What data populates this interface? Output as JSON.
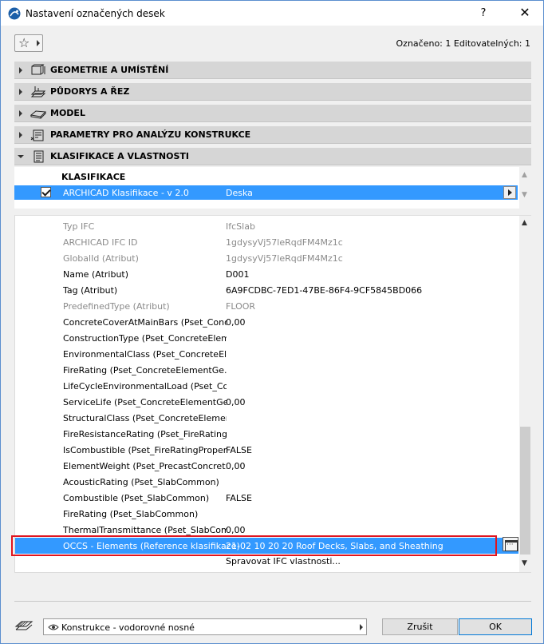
{
  "window": {
    "title": "Nastavení označených desek",
    "help_label": "?",
    "close_label": "✕"
  },
  "toolbar": {
    "favorites_icon": "star-icon",
    "selection_info": "Označeno: 1 Editovatelných: 1"
  },
  "sections": [
    {
      "label": "GEOMETRIE A UMÍSTĚNÍ",
      "icon": "geometry-icon",
      "expanded": false
    },
    {
      "label": "PŮDORYS A ŘEZ",
      "icon": "floorplan-icon",
      "expanded": false
    },
    {
      "label": "MODEL",
      "icon": "model-icon",
      "expanded": false
    },
    {
      "label": "PARAMETRY PRO ANALÝZU KONSTRUKCE",
      "icon": "structural-icon",
      "expanded": false
    },
    {
      "label": "KLASIFIKACE A VLASTNOSTI",
      "icon": "classification-icon",
      "expanded": true
    }
  ],
  "classification": {
    "header": "KLASIFIKACE",
    "row": {
      "checked": true,
      "system": "ARCHICAD Klasifikace - v 2.0",
      "value": "Deska"
    }
  },
  "properties": [
    {
      "name": "Typ IFC",
      "value": "IfcSlab",
      "gray": true
    },
    {
      "name": "ARCHICAD IFC ID",
      "value": "1gdysyVj57leRqdFM4Mz1c",
      "gray": true
    },
    {
      "name": "GlobalId (Atribut)",
      "value": "1gdysyVj57leRqdFM4Mz1c",
      "gray": true
    },
    {
      "name": "Name (Atribut)",
      "value": "D001",
      "gray": false
    },
    {
      "name": "Tag (Atribut)",
      "value": "6A9FCDBC-7ED1-47BE-86F4-9CF5845BD066",
      "gray": false
    },
    {
      "name": "PredefinedType (Atribut)",
      "value": "FLOOR",
      "gray": true
    },
    {
      "name": "ConcreteCoverAtMainBars (Pset_Conc...",
      "value": "0,00",
      "gray": false
    },
    {
      "name": "ConstructionType (Pset_ConcreteElem...",
      "value": "",
      "gray": false
    },
    {
      "name": "EnvironmentalClass (Pset_ConcreteEl...",
      "value": "",
      "gray": false
    },
    {
      "name": "FireRating (Pset_ConcreteElementGe...",
      "value": "",
      "gray": false
    },
    {
      "name": "LifeCycleEnvironmentalLoad (Pset_Co...",
      "value": "",
      "gray": false
    },
    {
      "name": "ServiceLife (Pset_ConcreteElementGe...",
      "value": "0,00",
      "gray": false
    },
    {
      "name": "StructuralClass (Pset_ConcreteElemen...",
      "value": "",
      "gray": false
    },
    {
      "name": "FireResistanceRating (Pset_FireRating...",
      "value": "",
      "gray": false
    },
    {
      "name": "IsCombustible (Pset_FireRatingProper...",
      "value": "FALSE",
      "gray": false
    },
    {
      "name": "ElementWeight (Pset_PrecastConcret...",
      "value": "0,00",
      "gray": false
    },
    {
      "name": "AcousticRating (Pset_SlabCommon)",
      "value": "",
      "gray": false
    },
    {
      "name": "Combustible (Pset_SlabCommon)",
      "value": "FALSE",
      "gray": false
    },
    {
      "name": "FireRating (Pset_SlabCommon)",
      "value": "",
      "gray": false
    },
    {
      "name": "ThermalTransmittance (Pset_SlabCom...",
      "value": "0,00",
      "gray": false
    }
  ],
  "selected_property": {
    "name": "OCCS - Elements (Reference klasifikace)",
    "value": "21-02 10 20 20 Roof Decks, Slabs, and Sheathing"
  },
  "manage_ifc_label": "Spravovat IFC vlastnosti...",
  "footer": {
    "layer_value": "Konstrukce - vodorovné nosné",
    "cancel_label": "Zrušit",
    "ok_label": "OK"
  },
  "colors": {
    "selection": "#3399ff",
    "highlight_box": "#e0141e",
    "section_bg": "#d6d6d6"
  }
}
